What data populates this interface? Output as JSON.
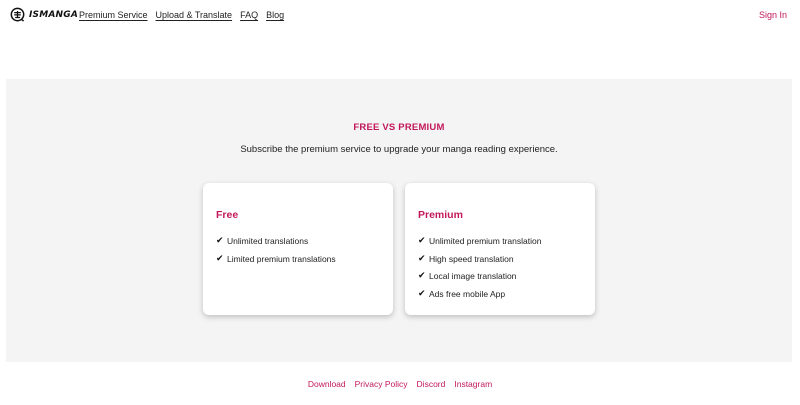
{
  "header": {
    "logo_text": "ISMANGA",
    "nav": [
      "Premium Service",
      "Upload & Translate",
      "FAQ",
      "Blog"
    ],
    "signin_label": "Sign In"
  },
  "main": {
    "heading": "FREE VS PREMIUM",
    "subheading": "Subscribe the premium service to upgrade your manga reading experience.",
    "plans": [
      {
        "title": "Free",
        "features": [
          "Unlimited translations",
          "Limited premium translations"
        ]
      },
      {
        "title": "Premium",
        "features": [
          "Unlimited premium translation",
          "High speed translation",
          "Local image translation",
          "Ads free mobile App"
        ]
      }
    ]
  },
  "footer": {
    "links": [
      "Download",
      "Privacy Policy",
      "Discord",
      "Instagram"
    ]
  },
  "icons": {
    "logo": "ismanga-logo-icon",
    "check": "checkmark-icon"
  },
  "colors": {
    "accent": "#c2185b",
    "band_background": "#f4f4f4"
  }
}
